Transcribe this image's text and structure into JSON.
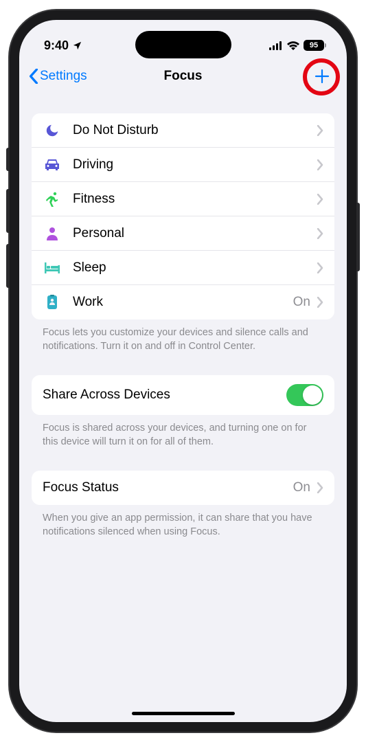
{
  "status_bar": {
    "time": "9:40",
    "battery": "95"
  },
  "nav": {
    "back_label": "Settings",
    "title": "Focus"
  },
  "focus_modes": [
    {
      "id": "dnd",
      "label": "Do Not Disturb",
      "value": "",
      "icon_color": "#5856d6"
    },
    {
      "id": "driving",
      "label": "Driving",
      "value": "",
      "icon_color": "#5856d6"
    },
    {
      "id": "fitness",
      "label": "Fitness",
      "value": "",
      "icon_color": "#30d158"
    },
    {
      "id": "personal",
      "label": "Personal",
      "value": "",
      "icon_color": "#af52de"
    },
    {
      "id": "sleep",
      "label": "Sleep",
      "value": "",
      "icon_color": "#40c8b6"
    },
    {
      "id": "work",
      "label": "Work",
      "value": "On",
      "icon_color": "#30b0c7"
    }
  ],
  "footer_focus": "Focus lets you customize your devices and silence calls and notifications. Turn it on and off in Control Center.",
  "share_across": {
    "label": "Share Across Devices",
    "enabled": true
  },
  "footer_share": "Focus is shared across your devices, and turning one on for this device will turn it on for all of them.",
  "focus_status": {
    "label": "Focus Status",
    "value": "On"
  },
  "footer_status": "When you give an app permission, it can share that you have notifications silenced when using Focus."
}
